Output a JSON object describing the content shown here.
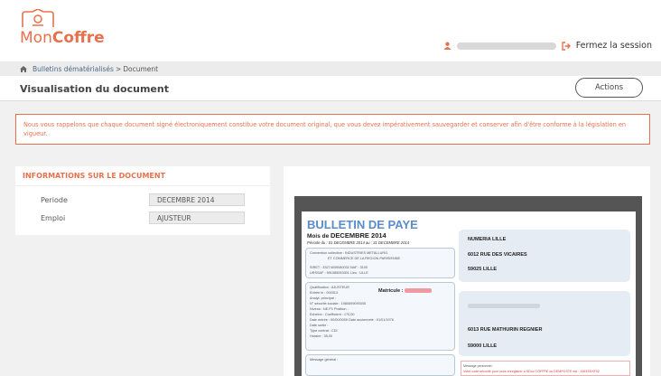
{
  "header": {
    "logo_mon": "Mon",
    "logo_coffre": "Coffre",
    "logout_label": "Fermez la session"
  },
  "breadcrumb": {
    "link": "Bulletins dématérialisés",
    "separator": ">",
    "current": "Document"
  },
  "page": {
    "title": "Visualisation du document",
    "actions_label": "Actions"
  },
  "alert": {
    "text": "Nous vous rappelons que chaque document signé électroniquement constitue votre document original, que vous devez impérativement sauvegarder et conserver afin d'être conforme à la législation en vigueur."
  },
  "info": {
    "title": "INFORMATIONS SUR LE DOCUMENT",
    "fields": [
      {
        "label": "Periode",
        "value": "DECEMBRE 2014"
      },
      {
        "label": "Emploi",
        "value": "AJUSTEUR"
      }
    ]
  },
  "document": {
    "title": "BULLETIN DE PAYE",
    "month_prefix": "Mois de",
    "month": "DECEMBRE 2014",
    "period": "Période du : 01 DECEMBRE 2014 au : 31 DECEMBRE 2014",
    "employer_name": "NUMERIA LILLE",
    "employer_street": "6012 RUE DES VICAIRES",
    "employer_city": "59025 LILLE",
    "employee_street": "6013 RUE MATHURIN REGNIER",
    "employee_city": "59000 LILLE",
    "company_box": [
      "Convention collective : INDUSTRIES METALLURG.",
      "ET COMMERCE DE LA REGION PARISIENNE",
      "SIRET : 33274009080032     NAF : 3100",
      "URSSAF : 591085053301     Lieu : ULLE"
    ],
    "emp_box": [
      "Qualification : AJUSTEUR",
      "Entrée le : 000013",
      "Analyt. principal :",
      "N° sécurité sociale : 1980899090005",
      "Niveau : NE.P1     Position :",
      "Echelon :     Coefficient : 170,00",
      "Date entrée : 00/00/0000     Date ancienneté : 01/01/1976",
      "Date sortie :",
      "Type contrat : CDI",
      "Horaire : 35,00"
    ],
    "matricule_label": "Matricule :",
    "message_label": "Message personnel :",
    "message_text": "Votre code sécurité pour vous enregistrer à SDoc COFFRE ou DEMPOSTE est : 1063SDXF02",
    "margin_label": "Message général :"
  }
}
